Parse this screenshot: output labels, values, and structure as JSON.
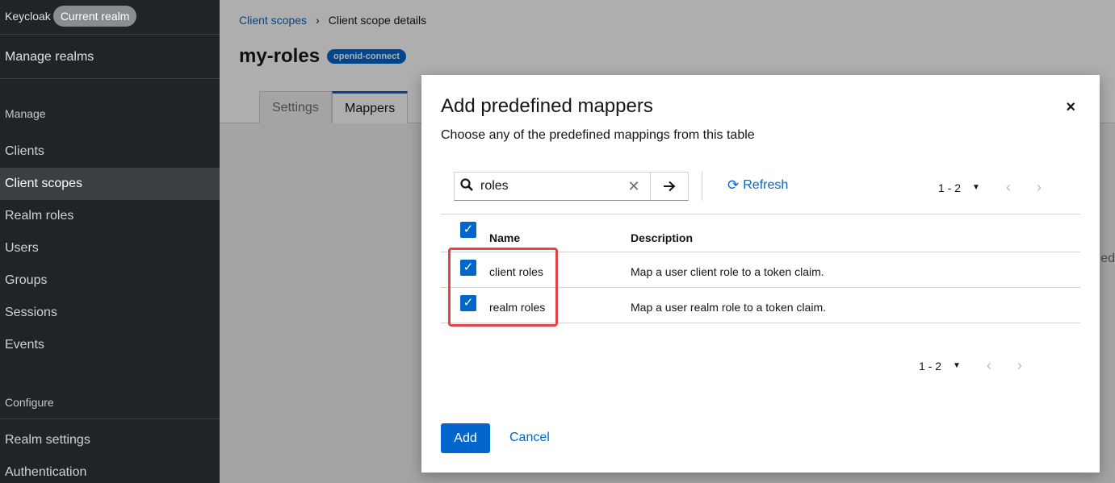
{
  "sidebar": {
    "brand": "Keycloak",
    "realm_pill": "Current realm",
    "manage_realms": "Manage realms",
    "manage_heading": "Manage",
    "manage_items": [
      "Clients",
      "Client scopes",
      "Realm roles",
      "Users",
      "Groups",
      "Sessions",
      "Events"
    ],
    "active_item": "Client scopes",
    "configure_heading": "Configure",
    "configure_items": [
      "Realm settings",
      "Authentication"
    ]
  },
  "page": {
    "breadcrumb_link": "Client scopes",
    "breadcrumb_current": "Client scope details",
    "title": "my-roles",
    "protocol_badge": "openid-connect",
    "tabs": [
      "Settings",
      "Mappers"
    ],
    "active_tab": "Mappers",
    "peek_text": "ed"
  },
  "modal": {
    "title": "Add predefined mappers",
    "close": "×",
    "description": "Choose any of the predefined mappings from this table",
    "search_value": "roles",
    "refresh_label": "Refresh",
    "pagination_top": "1 - 2",
    "pagination_bottom": "1 - 2",
    "columns": [
      "Name",
      "Description"
    ],
    "rows": [
      {
        "name": "client roles",
        "description": "Map a user client role to a token claim.",
        "checked": true
      },
      {
        "name": "realm roles",
        "description": "Map a user realm role to a token claim.",
        "checked": true
      }
    ],
    "add_label": "Add",
    "cancel_label": "Cancel"
  },
  "colors": {
    "accent": "#0066cc",
    "sidebar_bg": "#212427",
    "highlight": "#e04545"
  }
}
